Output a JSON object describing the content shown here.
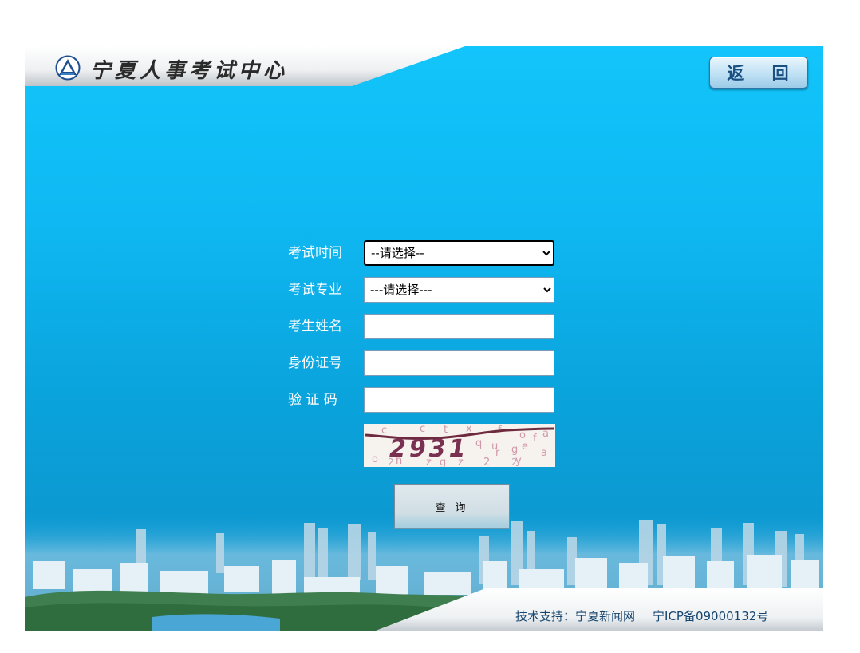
{
  "header": {
    "site_title": "宁夏人事考试中心",
    "back_label": "返 回",
    "logo_icon": "ningxia-exam-logo-icon"
  },
  "form": {
    "exam_time": {
      "label": "考试时间",
      "selected": "--请选择--"
    },
    "exam_major": {
      "label": "考试专业",
      "selected": "---请选择---"
    },
    "name": {
      "label": "考生姓名",
      "value": ""
    },
    "id_number": {
      "label": "身份证号",
      "value": ""
    },
    "captcha": {
      "label": "验 证 码",
      "value": "",
      "image_text": "2931"
    },
    "submit_label": "查 询"
  },
  "footer": {
    "tech_support": "技术支持：宁夏新闻网",
    "icp": "宁ICP备09000132号"
  },
  "colors": {
    "panel_top": "#12c5fb",
    "panel_bottom": "#0f8fc6",
    "footer_text": "#17456e",
    "button_text": "#1a4f82"
  }
}
